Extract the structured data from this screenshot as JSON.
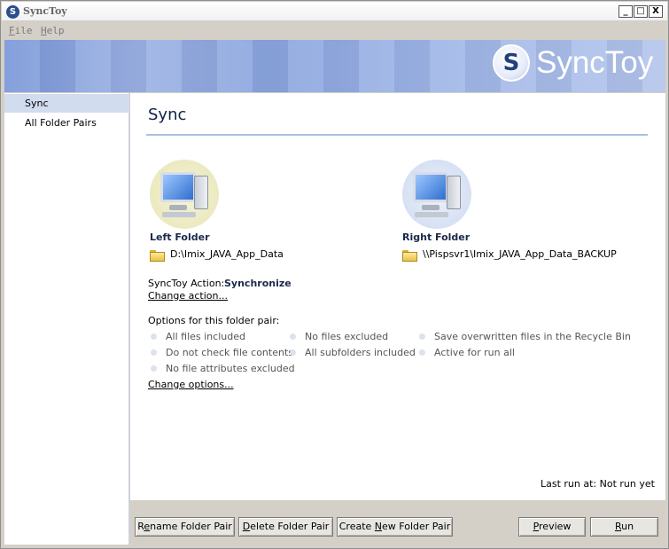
{
  "window": {
    "title": "SyncToy",
    "controls": {
      "minimize": "_",
      "maximize": "□",
      "close": "X"
    }
  },
  "menu": {
    "file": {
      "label": "File",
      "accel": "F",
      "rest": "ile"
    },
    "help": {
      "label": "Help",
      "accel": "H",
      "rest": "elp"
    }
  },
  "banner": {
    "logo_text": "SyncToy",
    "logo_glyph": "S"
  },
  "sidebar": {
    "items": [
      {
        "label": "Sync",
        "selected": true
      },
      {
        "label": "All Folder Pairs",
        "selected": false
      }
    ]
  },
  "main": {
    "title": "Sync",
    "left_folder": {
      "heading": "Left Folder",
      "path": "D:\\Imix_JAVA_App_Data"
    },
    "right_folder": {
      "heading": "Right Folder",
      "path": "\\\\Pispsvr1\\Imix_JAVA_App_Data_BACKUP"
    },
    "action": {
      "label": "SyncToy Action:",
      "value": "Synchronize",
      "change_link": "Change action..."
    },
    "options": {
      "label": "Options for this folder pair:",
      "items": [
        "All files included",
        "No files excluded",
        "Save overwritten files in the Recycle Bin",
        "Do not check file contents",
        "All subfolders included",
        "Active for run all",
        "No file attributes excluded"
      ],
      "change_link": "Change options..."
    },
    "last_run": "Last run at: Not run yet"
  },
  "buttons": {
    "rename": {
      "pre": "R",
      "accel": "e",
      "post": "name Folder Pair"
    },
    "delete": {
      "pre": "",
      "accel": "D",
      "post": "elete Folder Pair"
    },
    "create": {
      "pre": "Create ",
      "accel": "N",
      "post": "ew Folder Pair"
    },
    "preview": {
      "pre": "",
      "accel": "P",
      "post": "review"
    },
    "run": {
      "pre": "",
      "accel": "R",
      "post": "un"
    }
  },
  "colors": {
    "banner_accent": "#8ba6de",
    "sidebar_selected": "#d2dcef",
    "title_rule": "#a7c2e1",
    "heading_text": "#1b2a4a"
  }
}
